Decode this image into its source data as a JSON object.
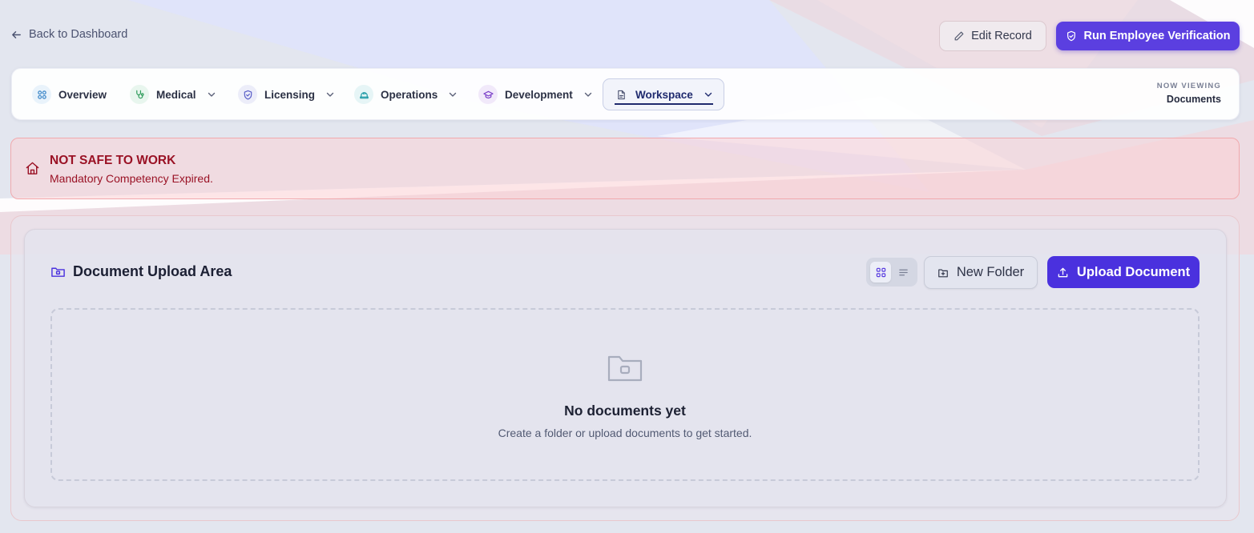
{
  "header": {
    "back_label": "Back to Dashboard",
    "edit_label": "Edit Record",
    "verify_label": "Run Employee Verification"
  },
  "nav": {
    "items": [
      {
        "label": "Overview",
        "icon": "grid-icon",
        "color": "#3a86c8"
      },
      {
        "label": "Medical",
        "icon": "stethoscope-icon",
        "color": "#2e9c5b"
      },
      {
        "label": "Licensing",
        "icon": "shield-icon",
        "color": "#5a5fc8"
      },
      {
        "label": "Operations",
        "icon": "hardhat-icon",
        "color": "#1f9aa6"
      },
      {
        "label": "Development",
        "icon": "graduation-cap-icon",
        "color": "#7a3ec8"
      },
      {
        "label": "Workspace",
        "icon": "document-icon",
        "color": "#4b5270"
      }
    ],
    "active": "Workspace",
    "now_viewing_label": "NOW VIEWING",
    "now_viewing_value": "Documents"
  },
  "alert": {
    "title": "NOT SAFE TO WORK",
    "message": "Mandatory Competency Expired.",
    "color": "#9a1225"
  },
  "documents": {
    "title": "Document Upload Area",
    "new_folder_label": "New Folder",
    "upload_label": "Upload Document",
    "view_mode": "grid",
    "empty_title": "No documents yet",
    "empty_subtitle": "Create a folder or upload documents to get started."
  },
  "colors": {
    "accent": "#5b3fe0",
    "upload": "#4a31de"
  }
}
